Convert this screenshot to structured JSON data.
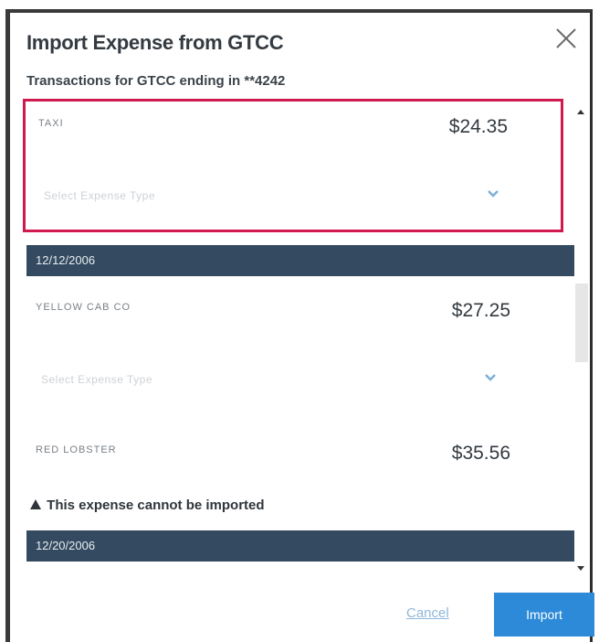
{
  "dialog": {
    "title": "Import Expense from GTCC",
    "subtitle": "Transactions for GTCC ending in **4242"
  },
  "transactions": [
    {
      "merchant": "TAXI",
      "amount": "$24.35",
      "type_placeholder": "Select Expense Type"
    },
    {
      "date": "12/12/2006"
    },
    {
      "merchant": "YELLOW CAB CO",
      "amount": "$27.25",
      "type_placeholder": "Select Expense Type"
    },
    {
      "merchant": "RED LOBSTER",
      "amount": "$35.56"
    },
    {
      "date": "12/20/2006"
    }
  ],
  "warning": "This expense cannot be imported",
  "footer": {
    "cancel_label": "Cancel",
    "import_label": "Import"
  },
  "colors": {
    "selected_border": "#d0194f",
    "date_bar": "#344a60",
    "import_button": "#2d8ad8",
    "cancel_link": "#8fb7dc"
  },
  "icons": {
    "close": "close-icon",
    "dropdown": "chevron-down-icon",
    "warning": "warning-icon"
  }
}
